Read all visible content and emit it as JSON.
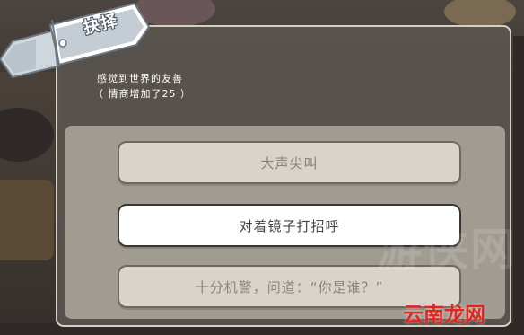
{
  "dialog": {
    "title": "抉择",
    "prompt_line1": "感觉到世界的友善",
    "prompt_line2": "（ 情商增加了25 ）"
  },
  "choices": [
    {
      "label": "大声尖叫",
      "state": "disabled"
    },
    {
      "label": "对着镜子打招呼",
      "state": "highlighted"
    },
    {
      "label": "十分机警，问道：“你是谁？”",
      "state": "disabled"
    }
  ],
  "watermarks": {
    "faint": "游侠网",
    "logo": "云南龙网"
  },
  "icons": {
    "title_tag": "luggage-tag-icon",
    "tag_arrow": "arrow-left-icon"
  },
  "colors": {
    "panel_bg": "#5c5652",
    "panel_border": "#d8cfc4",
    "choice_bg": "#d9d3c9",
    "choice_highlight_bg": "#ffffff",
    "logo_red": "#e0261e"
  }
}
